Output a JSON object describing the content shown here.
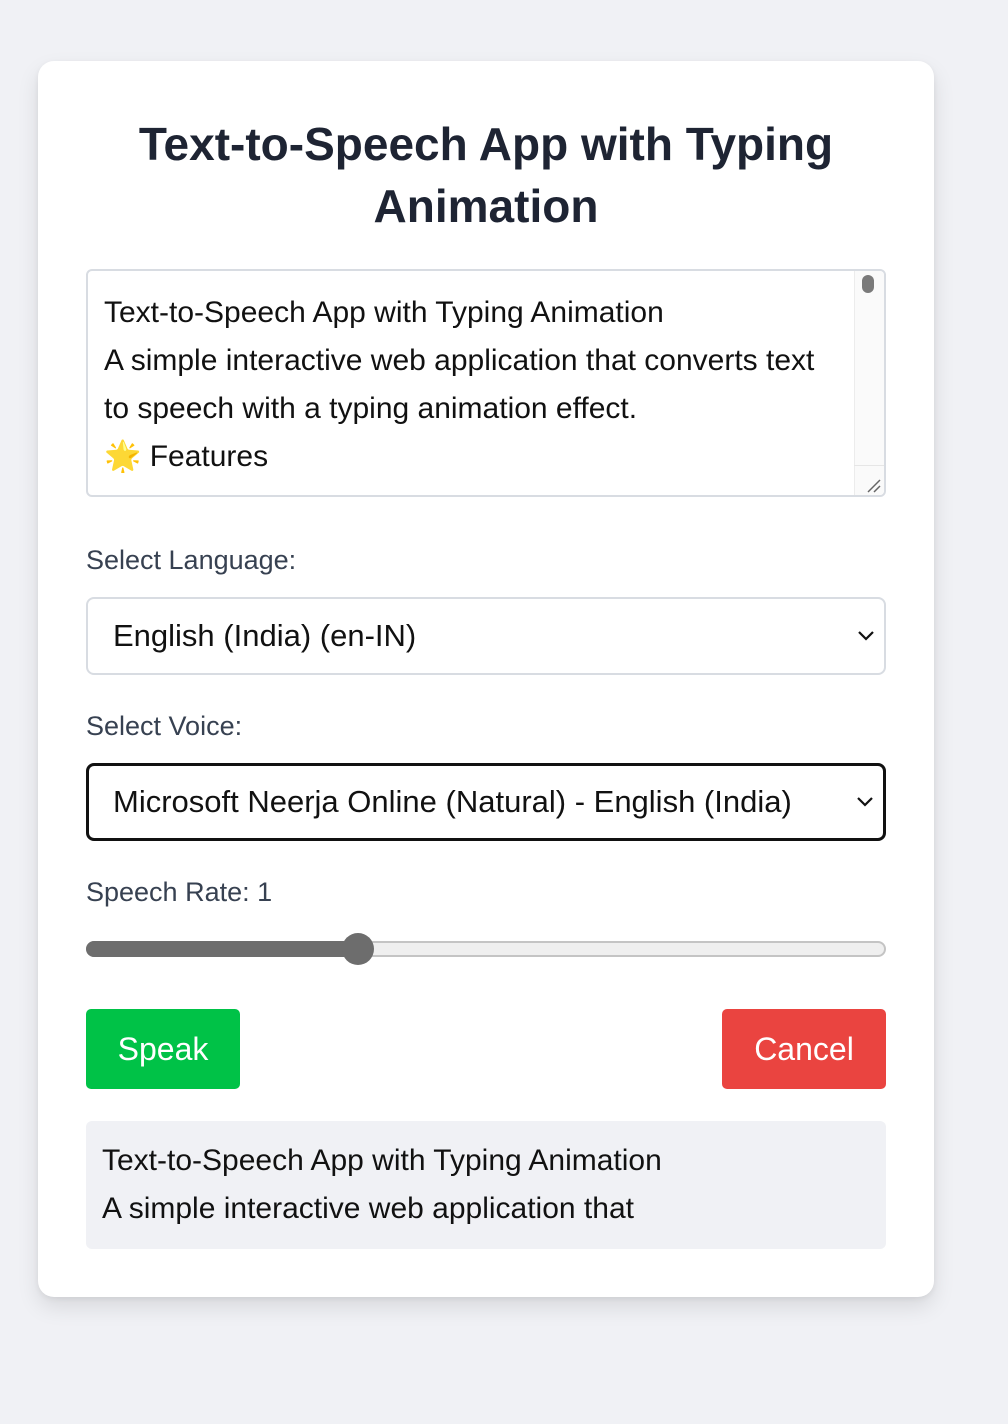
{
  "app": {
    "title": "Text-to-Speech App with Typing Animation"
  },
  "input": {
    "text": "Text-to-Speech App with Typing Animation\nA simple interactive web application that converts text to speech with a typing animation effect.\n🌟 Features"
  },
  "language": {
    "label": "Select Language:",
    "selected": "English (India) (en-IN)"
  },
  "voice": {
    "label": "Select Voice:",
    "selected": "Microsoft Neerja Online (Natural) - English (India)"
  },
  "rate": {
    "label": "Speech Rate: 1",
    "slider_fraction": 0.34
  },
  "buttons": {
    "speak": "Speak",
    "cancel": "Cancel"
  },
  "output": {
    "text": "Text-to-Speech App with Typing Animation\nA simple interactive web application that"
  },
  "colors": {
    "speak_button": "#00c247",
    "cancel_button": "#ea4440",
    "page_background": "#f0f1f5"
  },
  "icons": {
    "select_arrow": "chevron-down-icon",
    "scroll": "scrollbar-thumb",
    "resize": "resize-grip-icon"
  }
}
